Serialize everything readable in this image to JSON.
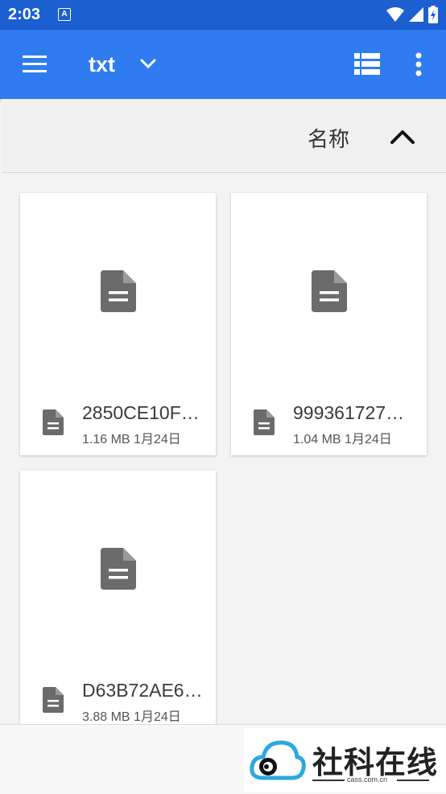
{
  "status_bar": {
    "time": "2:03",
    "notification_badge": "A",
    "icons": [
      "wifi-icon",
      "signal-icon",
      "battery-icon"
    ]
  },
  "app_bar": {
    "title": "txt",
    "icons": [
      "menu-icon",
      "chevron-down-icon",
      "list-view-icon",
      "more-vert-icon"
    ],
    "color": "#2f7cf0"
  },
  "sort_bar": {
    "label": "名称",
    "direction_icon": "chevron-up-icon"
  },
  "files": [
    {
      "name": "2850CE10F…",
      "size": "1.16 MB",
      "date": "1月24日",
      "icon": "document-icon"
    },
    {
      "name": "999361727…",
      "size": "1.04 MB",
      "date": "1月24日",
      "icon": "document-icon"
    },
    {
      "name": "D63B72AE6…",
      "size": "3.88 MB",
      "date": "1月24日",
      "icon": "document-icon"
    }
  ],
  "watermark": {
    "text": "社科在线",
    "url": "cass.com.cn"
  },
  "colors": {
    "status_bar": "#1c5fd1",
    "app_bar": "#2f7cf0",
    "icon_gray": "#6b6b6b"
  }
}
